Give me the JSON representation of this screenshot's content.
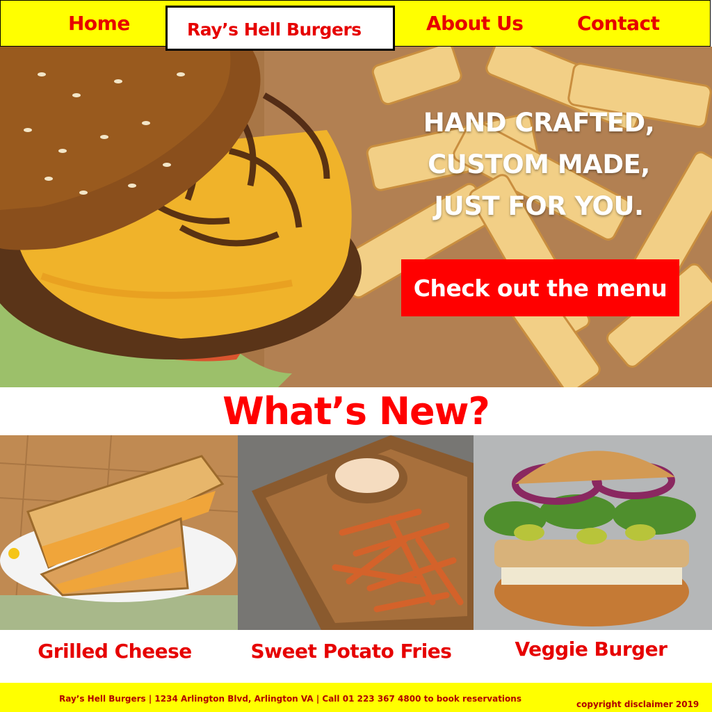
{
  "nav": {
    "home": "Home",
    "brand": "Ray’s Hell Burgers",
    "about": "About Us",
    "contact": "Contact"
  },
  "hero": {
    "tagline": [
      "HAND CRAFTED,",
      "CUSTOM MADE,",
      "JUST FOR YOU."
    ],
    "cta": "Check out the menu"
  },
  "whats_new": {
    "title": "What’s New?",
    "items": [
      {
        "name": "Grilled Cheese"
      },
      {
        "name": "Sweet Potato Fries"
      },
      {
        "name": "Veggie Burger"
      }
    ]
  },
  "footer": {
    "info": "Ray’s Hell Burgers |  1234 Arlington Blvd, Arlington VA  | Call 01 223 367 4800 to book reservations",
    "copyright": "copyright disclaimer 2019"
  },
  "colors": {
    "accent_yellow": "#ffff00",
    "accent_red": "#ff0000",
    "text_red": "#e60000"
  }
}
